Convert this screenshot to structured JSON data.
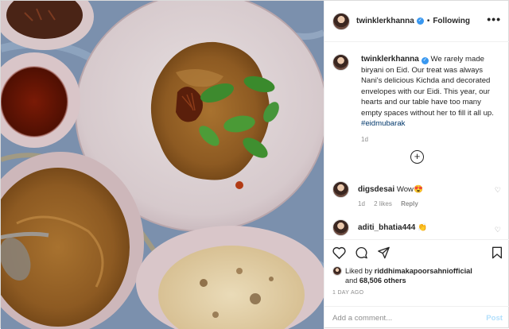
{
  "post": {
    "username": "twinklerkhanna",
    "follow_status": "Following",
    "more_icon": "•••"
  },
  "caption": {
    "username": "twinklerkhanna",
    "text": "We rarely made biryani on Eid. Our treat was always Nani's delicious Kichda and decorated envelopes with our Eidi. This year, our hearts and our table have too many empty spaces without her to fill it all up.",
    "hashtag": "#eidmubarak",
    "time": "1d"
  },
  "load_more_icon": "+",
  "comments": [
    {
      "username": "digsdesai",
      "text": "Wow😍",
      "time": "1d",
      "likes": "2 likes",
      "reply": "Reply"
    },
    {
      "username": "aditi_bhatia444",
      "text": "👏",
      "time": "",
      "likes": "",
      "reply": ""
    }
  ],
  "likes": {
    "prefix": "Liked by",
    "user": "riddhimakapoorsahniofficial",
    "and": "and",
    "count": "68,506 others"
  },
  "timestamp": "1 DAY AGO",
  "composer": {
    "placeholder": "Add a comment...",
    "post_label": "Post"
  },
  "colors": {
    "accent": "#3897f0",
    "post_disabled": "#b2dffc",
    "muted": "#8e8e8e"
  }
}
